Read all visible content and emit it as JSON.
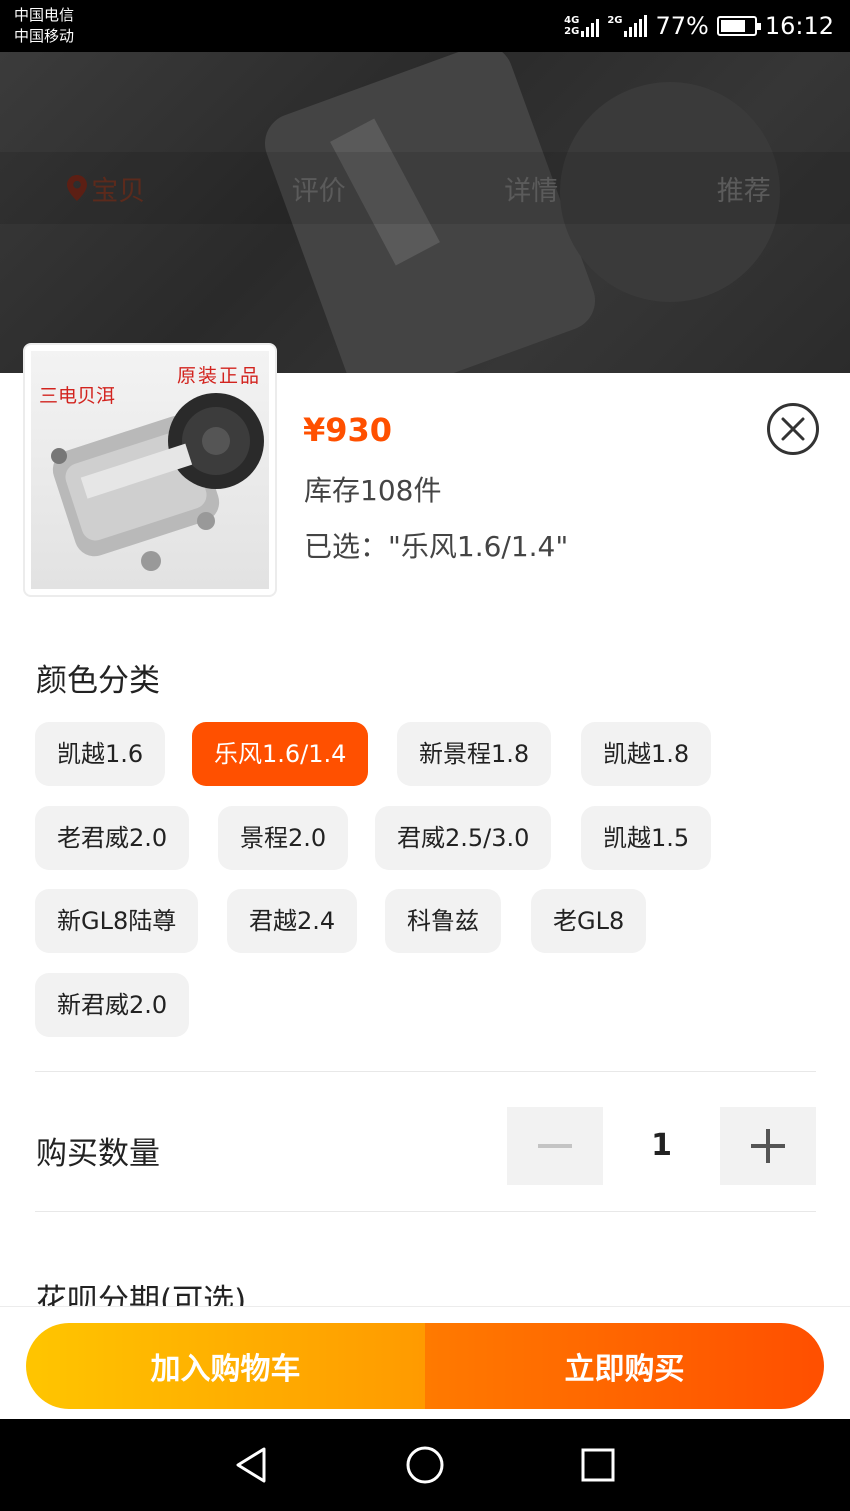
{
  "status_bar": {
    "carrier_1": "中国电信",
    "carrier_2": "中国移动",
    "net_1_top": "4G",
    "net_1_bottom": "2G",
    "net_2": "2G",
    "battery_percent": "77%",
    "battery_level": 0.77,
    "time": "16:12"
  },
  "background_tabs": [
    {
      "label": "宝贝",
      "icon": "location-pin-icon",
      "active": true
    },
    {
      "label": "评价",
      "active": false
    },
    {
      "label": "详情",
      "active": false
    },
    {
      "label": "推荐",
      "active": false
    }
  ],
  "product": {
    "image_text_left": "三电贝洱",
    "image_text_right": "原装正品",
    "price": "¥930",
    "stock": "库存108件",
    "selected": "已选：\"乐风1.6/1.4\""
  },
  "color_section": {
    "title": "颜色分类",
    "options": [
      {
        "label": "凯越1.6",
        "selected": false
      },
      {
        "label": "乐风1.6/1.4",
        "selected": true
      },
      {
        "label": "新景程1.8",
        "selected": false
      },
      {
        "label": "凯越1.8",
        "selected": false
      },
      {
        "label": "老君威2.0",
        "selected": false
      },
      {
        "label": "景程2.0",
        "selected": false
      },
      {
        "label": "君威2.5/3.0",
        "selected": false
      },
      {
        "label": "凯越1.5",
        "selected": false
      },
      {
        "label": "新GL8陆尊",
        "selected": false
      },
      {
        "label": "君越2.4",
        "selected": false
      },
      {
        "label": "科鲁兹",
        "selected": false
      },
      {
        "label": "老GL8",
        "selected": false
      },
      {
        "label": "新君威2.0",
        "selected": false
      }
    ]
  },
  "quantity": {
    "label": "购买数量",
    "value": "1"
  },
  "installment": {
    "label": "花呗分期(可选)"
  },
  "actions": {
    "add_to_cart": "加入购物车",
    "buy_now": "立即购买"
  },
  "colors": {
    "accent": "#ff5000",
    "chip_bg": "#f2f2f2",
    "cart_gradient": [
      "#ffc500",
      "#ff9a00"
    ],
    "buy_gradient": [
      "#ff7a00",
      "#ff4f00"
    ]
  }
}
